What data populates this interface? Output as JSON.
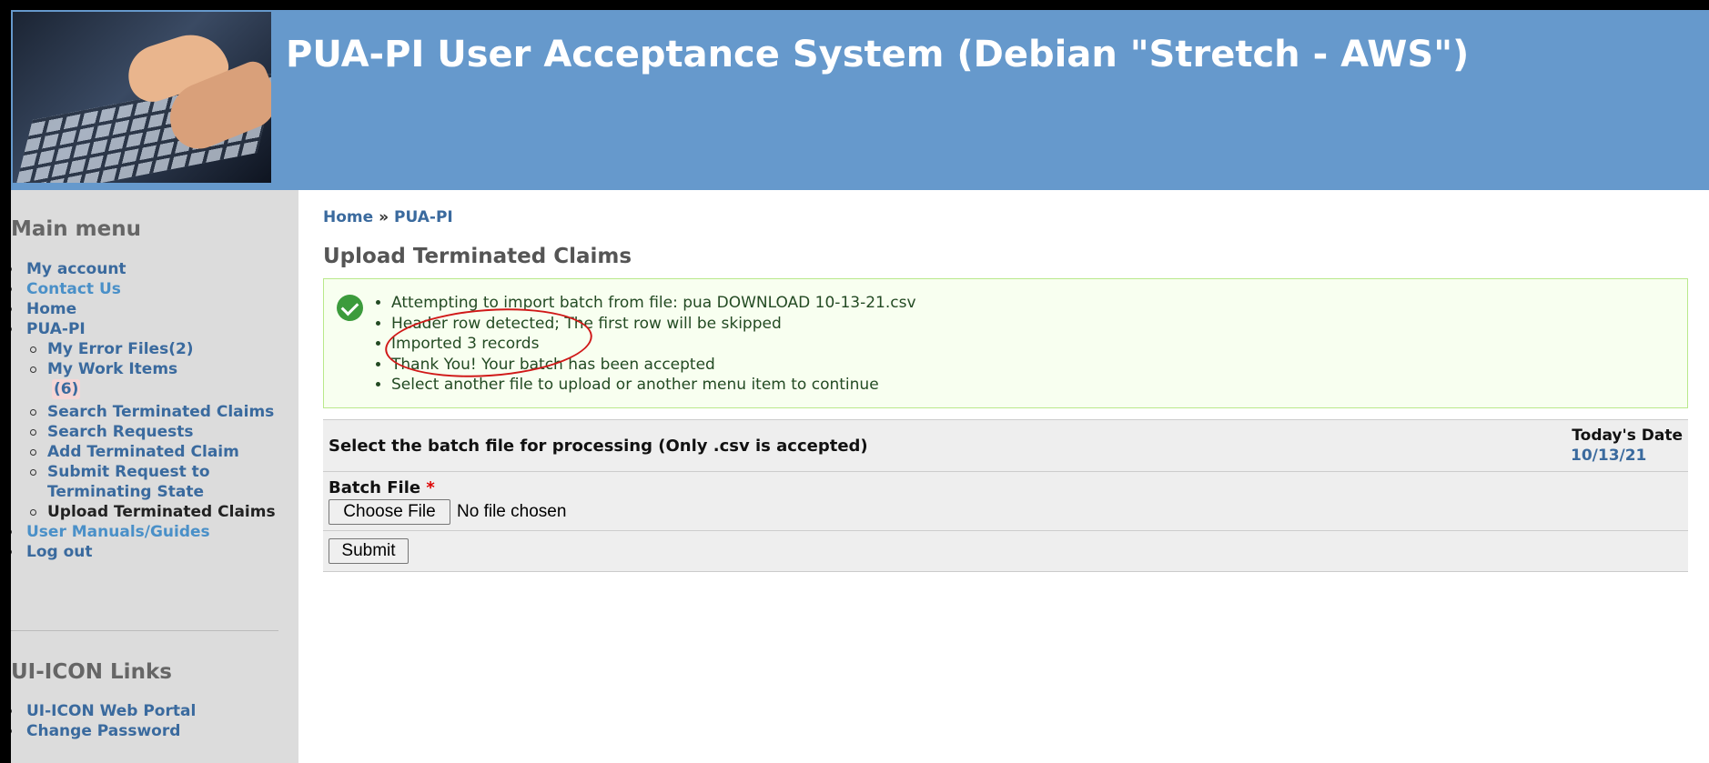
{
  "header": {
    "title": "PUA-PI User Acceptance System (Debian \"Stretch - AWS\")"
  },
  "sidebar": {
    "main_menu_title": "Main menu",
    "items": {
      "my_account": "My account",
      "contact_us": "Contact Us",
      "home": "Home",
      "pua_pi": "PUA-PI",
      "my_error_files": "My Error Files(2)",
      "my_work_items": "My Work Items",
      "my_work_items_count": "(6)",
      "search_terminated_claims": "Search Terminated Claims",
      "search_requests": "Search Requests",
      "add_terminated_claim": "Add Terminated Claim",
      "submit_request": "Submit Request to Terminating State",
      "upload_terminated_claims": "Upload Terminated Claims",
      "user_manuals": "User Manuals/Guides",
      "log_out": "Log out"
    },
    "links_title": "UI-ICON Links",
    "links": {
      "web_portal": "UI-ICON Web Portal",
      "change_password": "Change Password"
    }
  },
  "breadcrumb": {
    "home": "Home",
    "separator": "»",
    "current": "PUA-PI"
  },
  "page": {
    "title": "Upload Terminated Claims"
  },
  "messages": [
    "Attempting to import batch from file: pua DOWNLOAD 10-13-21.csv",
    "Header row detected; The first row will be skipped",
    "Imported 3 records",
    "Thank You! Your batch has been accepted",
    "Select another file to upload or another menu item to continue"
  ],
  "form": {
    "legend": "Select the batch file for processing (Only .csv is accepted)",
    "date_label": "Today's Date",
    "date_value": "10/13/21",
    "file_label": "Batch File",
    "required_mark": "*",
    "choose_button": "Choose File",
    "no_file_text": "No file chosen",
    "submit_button": "Submit"
  },
  "colors": {
    "header_bg": "#6699cc",
    "link": "#3a6a9e",
    "success_bg": "#f8fff0",
    "annotation": "#d01818"
  }
}
